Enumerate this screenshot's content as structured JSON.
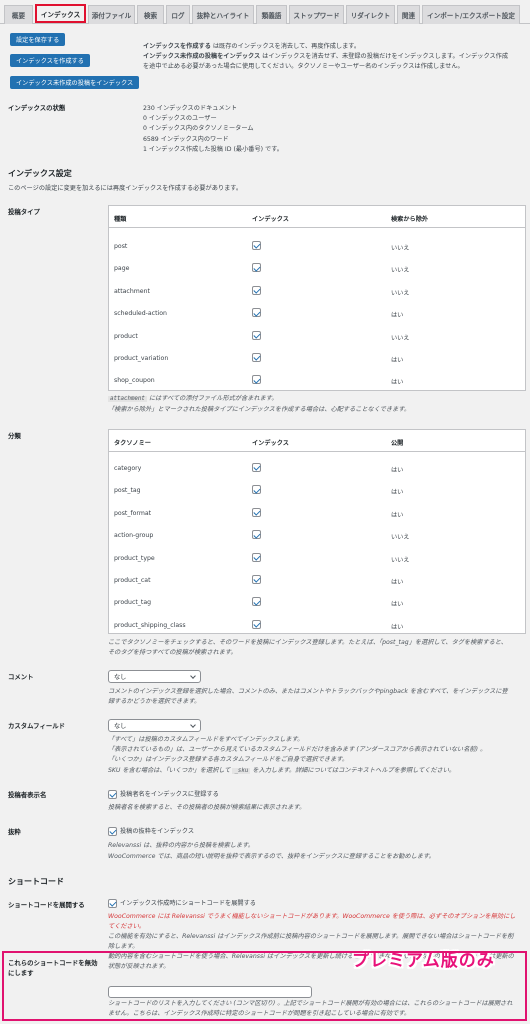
{
  "tabs": [
    "概要",
    "インデックス",
    "添付ファイル",
    "検索",
    "ログ",
    "抜粋とハイライト",
    "類義語",
    "ストップワード",
    "リダイレクト",
    "関連",
    "インポート/エクスポート設定"
  ],
  "buttons": {
    "save": "設定を保存する",
    "build": "インデックスを作成する",
    "build_unindexed": "インデックス未作成の投稿をインデックス"
  },
  "build_desc": {
    "line1_bold": "インデックスを作成する",
    "line1": " は既存のインデックスを消去して、再度作成します。",
    "line2_bold": "インデックス未作成の投稿をインデックス",
    "line2": " はインデックスを消去せず、未登録の投稿だけをインデックスします。インデックス作成",
    "line3": "を途中で止める必要があった場合に使用してください。タクソノミーやユーザー名のインデックスは作成しません。"
  },
  "status": {
    "label": "インデックスの状態",
    "lines": [
      "230 インデックスのドキュメント",
      "0 インデックスのユーザー",
      "0 インデックス内のタクソノミーターム",
      "6589 インデックス内のワード",
      "1 インデックス作成した投稿 ID (最小番号) です。"
    ]
  },
  "settings": {
    "heading": "インデックス設定",
    "note": "このページの設定に変更を加えるには再度インデックスを作成する必要があります。"
  },
  "post_types": {
    "label": "投稿タイプ",
    "headers": [
      "種類",
      "インデックス",
      "検索から除外"
    ],
    "rows": [
      {
        "name": "post",
        "exclude": "いいえ"
      },
      {
        "name": "page",
        "exclude": "いいえ"
      },
      {
        "name": "attachment",
        "exclude": "いいえ"
      },
      {
        "name": "scheduled-action",
        "exclude": "はい"
      },
      {
        "name": "product",
        "exclude": "いいえ"
      },
      {
        "name": "product_variation",
        "exclude": "はい"
      },
      {
        "name": "shop_coupon",
        "exclude": "はい"
      }
    ],
    "note1_code": "attachment",
    "note1": " にはすべての添付ファイル形式が含まれます。",
    "note2": "「検索から除外」とマークされた投稿タイプにインデックスを作成する場合は、心配することなくできます。"
  },
  "taxonomies": {
    "label": "分類",
    "headers": [
      "タクソノミー",
      "インデックス",
      "公開"
    ],
    "rows": [
      {
        "name": "category",
        "public": "はい"
      },
      {
        "name": "post_tag",
        "public": "はい"
      },
      {
        "name": "post_format",
        "public": "はい"
      },
      {
        "name": "action-group",
        "public": "いいえ"
      },
      {
        "name": "product_type",
        "public": "いいえ"
      },
      {
        "name": "product_cat",
        "public": "はい"
      },
      {
        "name": "product_tag",
        "public": "はい"
      },
      {
        "name": "product_shipping_class",
        "public": "はい"
      }
    ],
    "note1": "ここでタクソノミーをチェックすると、そのワードを投稿にインデックス登録します。たとえば、「post_tag」を選択して、タグを検索すると、",
    "note2": "そのタグを持つすべての投稿が検索されます。"
  },
  "comments": {
    "label": "コメント",
    "value": "なし",
    "desc1": "コメントのインデックス登録を選択した場合、コメントのみ、またはコメントやトラックバックやpingback を含むすべて、をインデックスに登",
    "desc2": "録するかどうかを選択できます。"
  },
  "custom_fields": {
    "label": "カスタムフィールド",
    "value": "なし",
    "desc1": "「すべて」は投稿のカスタムフィールドをすべてインデックスします。",
    "desc2": "「表示されているもの」は、ユーザーから見えているカスタムフィールドだけを含みます (アンダースコアから表示されていない名前) 。",
    "desc3": "「いくつか」はインデックス登録する各カスタムフィールドをご自身で選択できます。",
    "desc4a": "SKU を含む場合は、「いくつか」を選択して ",
    "desc4_code": "_sku",
    "desc4b": " を入力します。詳細についてはコンテキストヘルプを参照してください。"
  },
  "author": {
    "label": "投稿者表示名",
    "checkbox": "投稿者名をインデックスに登録する",
    "desc": "投稿者名を検索すると、その投稿者の投稿が検索結果に表示されます。"
  },
  "excerpt": {
    "label": "抜粋",
    "checkbox": "投稿の抜粋をインデックス",
    "desc1": "Relevanssi は、抜粋の内容から投稿を検索します。",
    "desc2": "WooCommerce では、商品の短い説明を抜粋で表示するので、抜粋をインデックスに登録することをお勧めします。"
  },
  "shortcodes": {
    "heading": "ショートコード",
    "expand_label": "ショートコードを展開する",
    "expand_checkbox": "インデックス作成時にショートコードを展開する",
    "warn1": "WooCommerce には Relevanssi でうまく機能しないショートコードがあります。WooCommerce を使う際は、必ずそのオプションを無効にし",
    "warn2": "てください。",
    "desc1": "この機能を有効にすると、Relevanssi はインデックス作成前に投稿内容のショートコードを展開します。展開できない場合はショートコードを削",
    "desc2": "除します。",
    "desc3": "動的内容を含むショートコードを使う場合、Relevanssi はインデックスを更新し続けることができないかもしれないので、インデックスは更新の",
    "desc4": "状態が反映されます。",
    "disable_label1": "これらのショートコードを無効",
    "disable_label2": "にします",
    "disable_desc1": "ショートコードのリストを入力してください (コンマ区切り) 。上記でショートコード展開が有効の場合には、これらのショートコードは展開され",
    "disable_desc2": "ません。こちらは、インデックス作成時に特定のショートコードが問題を引き起こしている場合に有効です。"
  },
  "badge": "プレミアム版のみ",
  "colors": {
    "accent": "#2271b1",
    "highlight": "#e0126f",
    "badge": "#e8127a"
  }
}
